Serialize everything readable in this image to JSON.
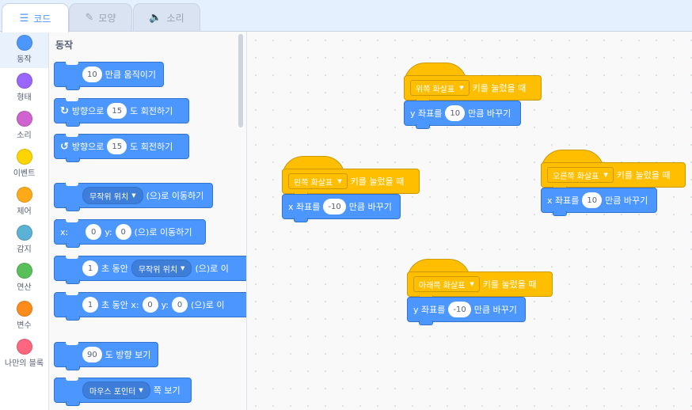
{
  "tabs": [
    {
      "label": "코드",
      "icon": "code-icon"
    },
    {
      "label": "모양",
      "icon": "brush-icon"
    },
    {
      "label": "소리",
      "icon": "speaker-icon"
    }
  ],
  "categories": [
    {
      "label": "동작",
      "color": "#4c97ff"
    },
    {
      "label": "형태",
      "color": "#9966ff"
    },
    {
      "label": "소리",
      "color": "#cf63cf"
    },
    {
      "label": "이벤트",
      "color": "#ffd500"
    },
    {
      "label": "제어",
      "color": "#ffab19"
    },
    {
      "label": "감지",
      "color": "#5cb1d6"
    },
    {
      "label": "연산",
      "color": "#59c059"
    },
    {
      "label": "변수",
      "color": "#ff8c1a"
    },
    {
      "label": "나만의 블록",
      "color": "#ff6680"
    }
  ],
  "palette": {
    "title": "동작",
    "move": {
      "value": "10",
      "text": "만큼 움직이기"
    },
    "turn_right": {
      "prefix": "방향으로",
      "value": "15",
      "suffix": "도 회전하기"
    },
    "turn_left": {
      "prefix": "방향으로",
      "value": "15",
      "suffix": "도 회전하기"
    },
    "goto_random": {
      "option": "무작위 위치",
      "suffix": "(으)로 이동하기"
    },
    "goto_xy": {
      "x_label": "x:",
      "x": "0",
      "y_label": "y:",
      "y": "0",
      "suffix": "(으)로 이동하기"
    },
    "glide_random": {
      "secs": "1",
      "mid": "초 동안",
      "option": "무작위 위치",
      "suffix": "(으)로 이"
    },
    "glide_xy": {
      "secs": "1",
      "mid": "초 동안 x:",
      "x": "0",
      "y_label": "y:",
      "y": "0",
      "suffix": "(으)로 이"
    },
    "point_dir": {
      "value": "90",
      "suffix": "도 방향 보기"
    },
    "point_towards": {
      "option": "마우스 포인터",
      "suffix": "쪽 보기"
    }
  },
  "scripts": [
    {
      "key": "위쪽 화살표",
      "when": "키를 눌렀을 때",
      "action_prefix": "y 좌표를",
      "value": "10",
      "action_suffix": "만큼 바꾸기"
    },
    {
      "key": "왼쪽 화살표",
      "when": "키를 눌렀을 때",
      "action_prefix": "x 좌표를",
      "value": "-10",
      "action_suffix": "만큼 바꾸기"
    },
    {
      "key": "오른쪽 화살표",
      "when": "키를 눌렀을 때",
      "action_prefix": "x 좌표를",
      "value": "10",
      "action_suffix": "만큼 바꾸기"
    },
    {
      "key": "아래쪽 화살표",
      "when": "키를 눌렀을 때",
      "action_prefix": "y 좌표를",
      "value": "-10",
      "action_suffix": "만큼 바꾸기"
    }
  ]
}
